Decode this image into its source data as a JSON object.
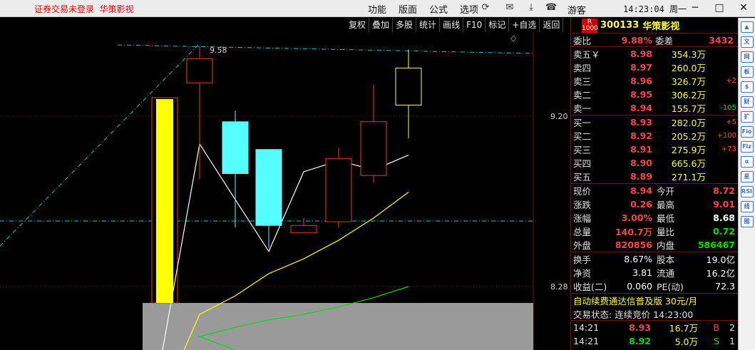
{
  "titlebar": {
    "login_status": "证券交易未登录",
    "stock_name": "华策影视",
    "menu": [
      "功能",
      "版面",
      "公式",
      "选项"
    ],
    "user": "游客",
    "time": "14:23:04 周一"
  },
  "toolbar": [
    "复权",
    "叠加",
    "多股",
    "统计",
    "画线",
    "F10",
    "标记",
    "+自选",
    "返回"
  ],
  "price_axis": {
    "upper": "9.20",
    "lower": "8.28",
    "peak_label": "9.58"
  },
  "chart_data": {
    "type": "candlestick",
    "candles": [
      {
        "open": 9.38,
        "close": 9.51,
        "high": 9.58,
        "low": 8.86,
        "color": "red"
      },
      {
        "open": 9.17,
        "close": 8.89,
        "high": 9.23,
        "low": 8.6,
        "color": "cyan"
      },
      {
        "open": 9.02,
        "close": 8.61,
        "high": 9.02,
        "low": 8.49,
        "color": "cyan"
      },
      {
        "open": 8.57,
        "close": 8.61,
        "high": 8.65,
        "low": 8.57,
        "color": "red"
      },
      {
        "open": 8.63,
        "close": 8.97,
        "high": 9.03,
        "low": 8.6,
        "color": "red"
      },
      {
        "open": 8.88,
        "close": 9.17,
        "high": 9.37,
        "low": 8.84,
        "color": "red"
      },
      {
        "open": 9.26,
        "close": 9.46,
        "high": 9.56,
        "low": 9.08,
        "color": "yellow"
      }
    ],
    "ma_white": [
      9.05,
      8.75,
      8.47,
      8.9,
      8.96,
      8.91,
      8.99
    ],
    "ma_yellow": [
      8.13,
      8.23,
      8.35,
      8.43,
      8.53,
      8.65,
      8.79
    ],
    "ma_green": [
      8.01,
      8.06,
      8.1,
      8.13,
      8.17,
      8.22,
      8.28
    ]
  },
  "quote": {
    "code": "300133",
    "name": "华策影视",
    "badge": "R 1000",
    "weibi_label": "委比",
    "weibi": "9.88%",
    "weicha_label": "委差",
    "weicha": "3432",
    "asks": [
      {
        "label": "卖五￥",
        "price": "8.98",
        "vol": "354.3万",
        "chg": ""
      },
      {
        "label": "卖四",
        "price": "8.97",
        "vol": "260.0万",
        "chg": ""
      },
      {
        "label": "卖三",
        "price": "8.96",
        "vol": "326.7万",
        "chg": "+2"
      },
      {
        "label": "卖二",
        "price": "8.95",
        "vol": "306.2万",
        "chg": ""
      },
      {
        "label": "卖一",
        "price": "8.94",
        "vol": "155.7万",
        "chg": "-105"
      }
    ],
    "bids": [
      {
        "label": "买一",
        "price": "8.93",
        "vol": "282.0万",
        "chg": "+5"
      },
      {
        "label": "买二",
        "price": "8.92",
        "vol": "205.2万",
        "chg": "+100"
      },
      {
        "label": "买三",
        "price": "8.91",
        "vol": "275.9万",
        "chg": "+73"
      },
      {
        "label": "买四",
        "price": "8.90",
        "vol": "665.6万",
        "chg": ""
      },
      {
        "label": "买五",
        "price": "8.89",
        "vol": "271.1万",
        "chg": ""
      }
    ],
    "stats": [
      {
        "k": "现价",
        "v": "8.94",
        "vc": "red",
        "k2": "今开",
        "v2": "8.72",
        "v2c": "red"
      },
      {
        "k": "涨跌",
        "v": "0.26",
        "vc": "red",
        "k2": "最高",
        "v2": "9.01",
        "v2c": "red"
      },
      {
        "k": "涨幅",
        "v": "3.00%",
        "vc": "red",
        "k2": "最低",
        "v2": "8.68",
        "v2c": "white"
      },
      {
        "k": "总量",
        "v": "140.7万",
        "vc": "red",
        "k2": "量比",
        "v2": "0.72",
        "v2c": "green"
      },
      {
        "k": "外盘",
        "v": "820856",
        "vc": "red",
        "k2": "内盘",
        "v2": "586467",
        "v2c": "green"
      }
    ],
    "stats2": [
      {
        "k": "换手",
        "v": "8.67%",
        "k2": "股本",
        "v2": "19.0亿"
      },
      {
        "k": "净资",
        "v": "3.81",
        "k2": "流通",
        "v2": "16.2亿"
      },
      {
        "k": "收益(二)",
        "v": "0.060",
        "k2": "PE(动)",
        "v2": "72.3"
      }
    ],
    "ad": "自动续费通达信普及版 30元/月",
    "status": "交易状态: 连续竞价 14:23:00",
    "ticks": [
      {
        "time": "14:21",
        "price": "8.93",
        "vol": "16.7万",
        "side": "B",
        "n": "2"
      },
      {
        "time": "14:21",
        "price": "8.92",
        "vol": "5.0万",
        "side": "S",
        "n": "1"
      }
    ]
  },
  "sidebar_icons": [
    "▲",
    "文",
    "网",
    "板",
    "$",
    "财",
    "扩",
    "Fio",
    "Fiz",
    "α",
    "星",
    "RSI",
    "线",
    "图"
  ]
}
